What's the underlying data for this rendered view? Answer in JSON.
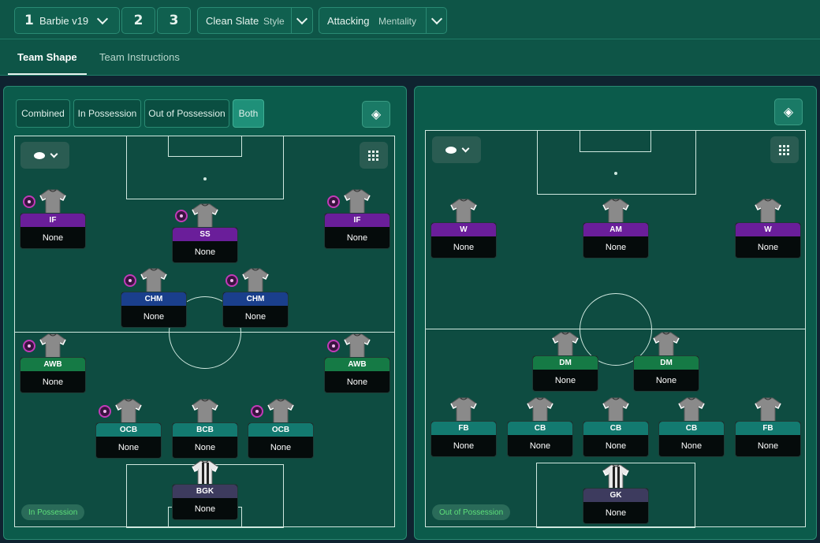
{
  "tactic": {
    "slot1": "1",
    "name": "Barbie v19",
    "slot2": "2",
    "slot3": "3"
  },
  "style": {
    "value": "Clean Slate",
    "label": "Style"
  },
  "mentality": {
    "value": "Attacking",
    "label": "Mentality"
  },
  "tabs": [
    {
      "label": "Team Shape",
      "active": true
    },
    {
      "label": "Team Instructions",
      "active": false
    }
  ],
  "view_modes": [
    {
      "label": "Combined",
      "active": false
    },
    {
      "label": "In Possession",
      "active": false
    },
    {
      "label": "Out of Possession",
      "active": false
    },
    {
      "label": "Both",
      "active": true
    }
  ],
  "left_pitch": {
    "mode_label": "In Possession",
    "players": [
      {
        "role": "IF",
        "duty": "None",
        "color": "#6a1e9a",
        "badge": true
      },
      {
        "role": "SS",
        "duty": "None",
        "color": "#6a1e9a",
        "badge": true
      },
      {
        "role": "IF",
        "duty": "None",
        "color": "#6a1e9a",
        "badge": true
      },
      {
        "role": "CHM",
        "duty": "None",
        "color": "#1a3f8c",
        "badge": true
      },
      {
        "role": "CHM",
        "duty": "None",
        "color": "#1a3f8c",
        "badge": true
      },
      {
        "role": "AWB",
        "duty": "None",
        "color": "#157a45",
        "badge": true
      },
      {
        "role": "AWB",
        "duty": "None",
        "color": "#157a45",
        "badge": true
      },
      {
        "role": "OCB",
        "duty": "None",
        "color": "#137a70",
        "badge": true
      },
      {
        "role": "BCB",
        "duty": "None",
        "color": "#137a70",
        "badge": false
      },
      {
        "role": "OCB",
        "duty": "None",
        "color": "#137a70",
        "badge": true
      },
      {
        "role": "BGK",
        "duty": "None",
        "color": "#3d3b5e",
        "badge": false,
        "gk": true
      }
    ]
  },
  "right_pitch": {
    "mode_label": "Out of Possession",
    "players": [
      {
        "role": "W",
        "duty": "None",
        "color": "#6a1e9a"
      },
      {
        "role": "AM",
        "duty": "None",
        "color": "#6a1e9a"
      },
      {
        "role": "W",
        "duty": "None",
        "color": "#6a1e9a"
      },
      {
        "role": "DM",
        "duty": "None",
        "color": "#157a45"
      },
      {
        "role": "DM",
        "duty": "None",
        "color": "#157a45"
      },
      {
        "role": "FB",
        "duty": "None",
        "color": "#137a70"
      },
      {
        "role": "CB",
        "duty": "None",
        "color": "#137a70"
      },
      {
        "role": "CB",
        "duty": "None",
        "color": "#137a70"
      },
      {
        "role": "CB",
        "duty": "None",
        "color": "#137a70"
      },
      {
        "role": "FB",
        "duty": "None",
        "color": "#137a70"
      },
      {
        "role": "GK",
        "duty": "None",
        "color": "#3d3b5e",
        "gk": true
      }
    ]
  }
}
